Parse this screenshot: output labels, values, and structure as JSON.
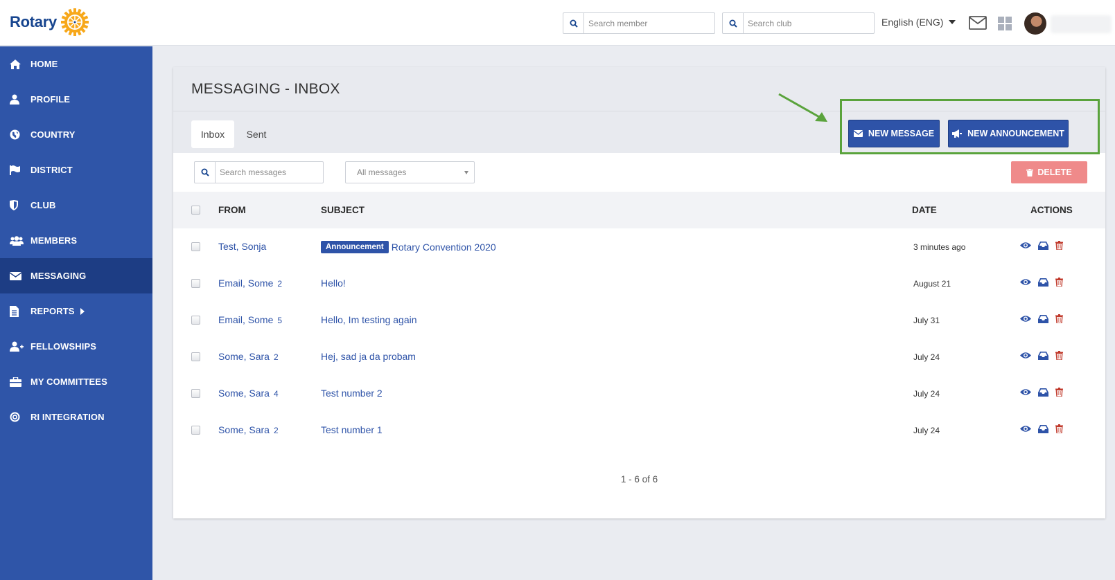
{
  "brand": {
    "name": "Rotary"
  },
  "header": {
    "search_member_placeholder": "Search member",
    "search_club_placeholder": "Search club",
    "language": "English (ENG)"
  },
  "sidebar": {
    "items": [
      {
        "label": "HOME",
        "icon": "home-icon"
      },
      {
        "label": "PROFILE",
        "icon": "user-icon"
      },
      {
        "label": "COUNTRY",
        "icon": "globe-icon"
      },
      {
        "label": "DISTRICT",
        "icon": "flag-icon"
      },
      {
        "label": "CLUB",
        "icon": "shield-icon"
      },
      {
        "label": "MEMBERS",
        "icon": "users-icon"
      },
      {
        "label": "MESSAGING",
        "icon": "envelope-icon",
        "active": true
      },
      {
        "label": "REPORTS",
        "icon": "document-icon"
      },
      {
        "label": "FELLOWSHIPS",
        "icon": "user-plus-icon"
      },
      {
        "label": "MY COMMITTEES",
        "icon": "briefcase-icon"
      },
      {
        "label": "RI INTEGRATION",
        "icon": "target-icon"
      }
    ]
  },
  "main": {
    "title": "MESSAGING - INBOX",
    "tabs": [
      {
        "label": "Inbox",
        "active": true
      },
      {
        "label": "Sent"
      }
    ],
    "new_message_label": "NEW MESSAGE",
    "new_announcement_label": "NEW ANNOUNCEMENT",
    "search_messages_placeholder": "Search messages",
    "filter_selected": "All messages",
    "delete_label": "DELETE",
    "columns": {
      "from": "FROM",
      "subject": "SUBJECT",
      "date": "DATE",
      "actions": "ACTIONS"
    },
    "messages": [
      {
        "from": "Test, Sonja",
        "count": "",
        "badge": "Announcement",
        "subject": "Rotary Convention 2020",
        "date": "3 minutes ago"
      },
      {
        "from": "Email, Some",
        "count": "2",
        "badge": "",
        "subject": "Hello!",
        "date": "August 21"
      },
      {
        "from": "Email, Some",
        "count": "5",
        "badge": "",
        "subject": "Hello, Im testing again",
        "date": "July 31"
      },
      {
        "from": "Some, Sara",
        "count": "2",
        "badge": "",
        "subject": "Hej, sad ja da probam",
        "date": "July 24"
      },
      {
        "from": "Some, Sara",
        "count": "4",
        "badge": "",
        "subject": "Test number 2",
        "date": "July 24"
      },
      {
        "from": "Some, Sara",
        "count": "2",
        "badge": "",
        "subject": "Test number 1",
        "date": "July 24"
      }
    ],
    "pagination": "1 - 6 of 6"
  },
  "colors": {
    "sidebar": "#2f55a8",
    "sidebar_active": "#1d3d84",
    "primary": "#2e53a8",
    "delete": "#ef8a8a",
    "highlight": "#5aa33c",
    "trash": "#c0392b"
  }
}
